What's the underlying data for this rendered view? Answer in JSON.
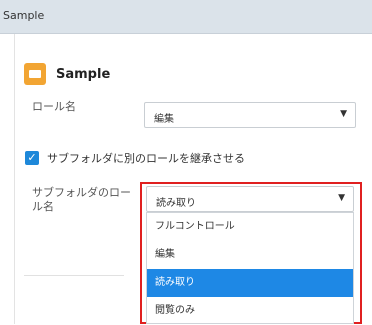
{
  "window": {
    "title": "Sample"
  },
  "heading": {
    "title": "Sample",
    "icon": "folder-icon"
  },
  "role_field": {
    "label": "ロール名",
    "value": "編集"
  },
  "inherit_checkbox": {
    "checked": true,
    "label": "サブフォルダに別のロールを継承させる"
  },
  "subfolder_role": {
    "label_line1": "サブフォルダのロー",
    "label_line2": "ル名",
    "value": "読み取り",
    "options": [
      "フルコントロール",
      "編集",
      "読み取り",
      "閲覧のみ"
    ],
    "selected_index": 2
  },
  "colors": {
    "accent": "#1e88e5",
    "highlight": "#e02020",
    "folder": "#f2a533"
  }
}
